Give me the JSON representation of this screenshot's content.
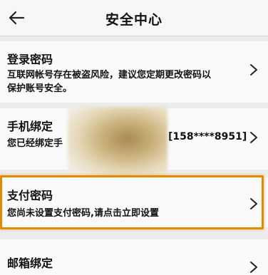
{
  "header": {
    "title": "安全中心",
    "back_icon": "arrow-left-icon"
  },
  "items": [
    {
      "title": "登录密码",
      "desc_line1": "互联网帐号存在被盗风险，建议您定期更改密码以",
      "desc_line2": "保护账号安全。"
    },
    {
      "title": "手机绑定",
      "desc": "您已经绑定手",
      "value": "[158****8951]"
    },
    {
      "title": "支付密码",
      "desc": "您尚未设置支付密码,请点击立即设置"
    },
    {
      "title": "邮箱绑定"
    }
  ],
  "colors": {
    "highlight": "#e58a00",
    "background": "#ececec",
    "card": "#fafafa"
  }
}
